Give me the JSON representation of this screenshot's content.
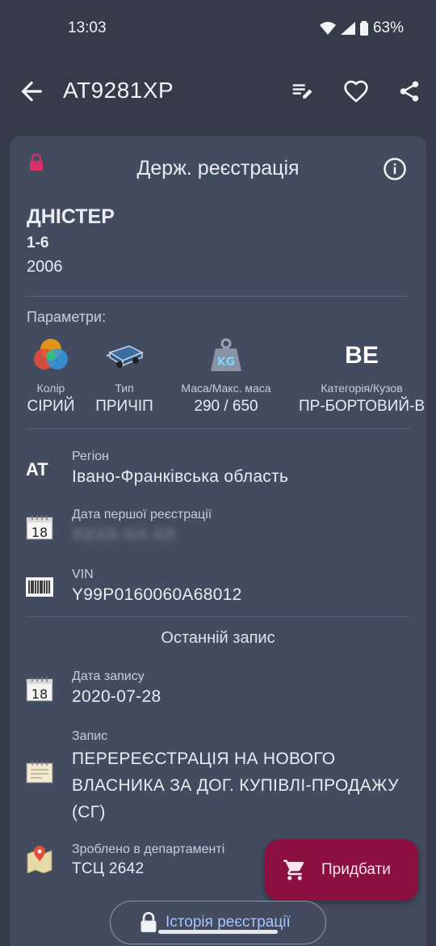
{
  "status": {
    "time": "13:03",
    "battery": "63%"
  },
  "appbar": {
    "title": "АТ9281ХР"
  },
  "card": {
    "title": "Держ. реєстрація",
    "make": "ДНІСТЕР",
    "model": "1-6",
    "year": "2006",
    "params_label": "Параметри:",
    "params": [
      {
        "label": "Колір",
        "value": "СІРИЙ"
      },
      {
        "label": "Тип",
        "value": "ПРИЧІП"
      },
      {
        "label": "Маса/Макс. маса",
        "value": "290 / 650"
      },
      {
        "label": "Категорія/Кузов",
        "value": "ПР-БОРТОВИЙ-В",
        "badge": "BE"
      }
    ],
    "region": {
      "code": "AT",
      "label": "Регіон",
      "value": "Івано-Франківська область"
    },
    "first_reg": {
      "label": "Дата першої реєстрації",
      "value": "XXXX-XX-XX",
      "calendar_day": "18"
    },
    "vin": {
      "label": "VIN",
      "value": "Y99P0160060A68012"
    },
    "last_record_title": "Останній запис",
    "record_date": {
      "label": "Дата запису",
      "value": "2020-07-28",
      "calendar_day": "18"
    },
    "record": {
      "label": "Запис",
      "value_lines": [
        "ПЕРЕРЕЄСТРАЦІЯ НА НОВОГО",
        "ВЛАСНИКА ЗА ДОГ. КУПІВЛІ-ПРОДАЖУ",
        "(СГ)"
      ]
    },
    "department": {
      "label": "Зроблено в департаменті",
      "value": "ТСЦ 2642"
    }
  },
  "fab": {
    "label": "Придбати"
  },
  "history_button": {
    "label": "Історія реєстрації"
  },
  "colors": {
    "background": "#353b48",
    "card": "#434b5f",
    "fab": "#8b1040",
    "accent_red": "#d6336c",
    "link": "#a9c4ff"
  },
  "icons": [
    "back-arrow-icon",
    "edit-list-icon",
    "heart-icon",
    "share-icon",
    "lock-icon",
    "info-icon",
    "color-palette-icon",
    "trailer-icon",
    "weight-icon",
    "calendar-icon",
    "barcode-icon",
    "document-icon",
    "map-pin-icon",
    "cart-icon"
  ]
}
